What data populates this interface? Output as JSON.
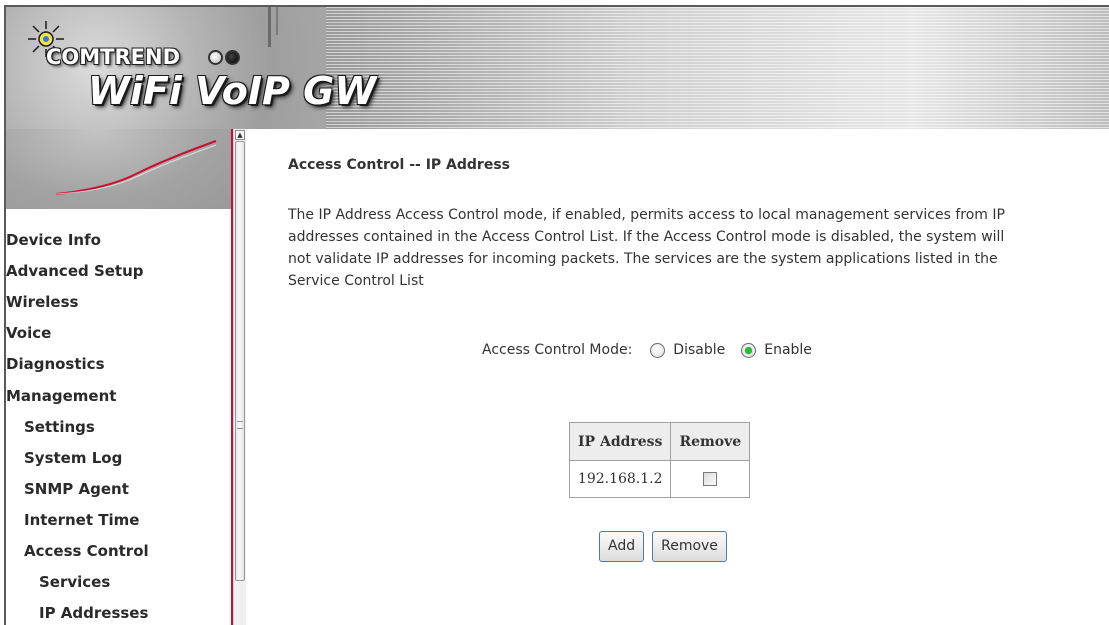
{
  "header": {
    "brand": "COMTREND",
    "product": "WiFi VoIP GW"
  },
  "nav": {
    "items": [
      {
        "label": "Device Info",
        "level": 0
      },
      {
        "label": "Advanced Setup",
        "level": 0
      },
      {
        "label": "Wireless",
        "level": 0
      },
      {
        "label": "Voice",
        "level": 0
      },
      {
        "label": "Diagnostics",
        "level": 0
      },
      {
        "label": "Management",
        "level": 0
      },
      {
        "label": "Settings",
        "level": 1
      },
      {
        "label": "System Log",
        "level": 1
      },
      {
        "label": "SNMP Agent",
        "level": 1
      },
      {
        "label": "Internet Time",
        "level": 1
      },
      {
        "label": "Access Control",
        "level": 1
      },
      {
        "label": "Services",
        "level": 2
      },
      {
        "label": "IP Addresses",
        "level": 2
      }
    ]
  },
  "main": {
    "title": "Access Control -- IP Address",
    "description": "The IP Address Access Control mode, if enabled, permits access to local management services from IP addresses contained in the Access Control List. If the Access Control mode is disabled, the system will not validate IP addresses for incoming packets. The services are the system applications listed in the Service Control List",
    "mode": {
      "label": "Access Control Mode:",
      "options": [
        {
          "label": "Disable",
          "selected": false
        },
        {
          "label": "Enable",
          "selected": true
        }
      ]
    },
    "table": {
      "headers": [
        "IP Address",
        "Remove"
      ],
      "rows": [
        {
          "ip": "192.168.1.2",
          "remove_checked": false
        }
      ]
    },
    "buttons": {
      "add": "Add",
      "remove": "Remove"
    }
  },
  "colors": {
    "nav_divider": "#c8102e",
    "radio_selected": "#2dbb3a",
    "button_border": "#4d7aa8"
  },
  "icons": [
    "sun-logo-icon",
    "scroll-up-arrow-icon",
    "swoosh-graphic"
  ]
}
